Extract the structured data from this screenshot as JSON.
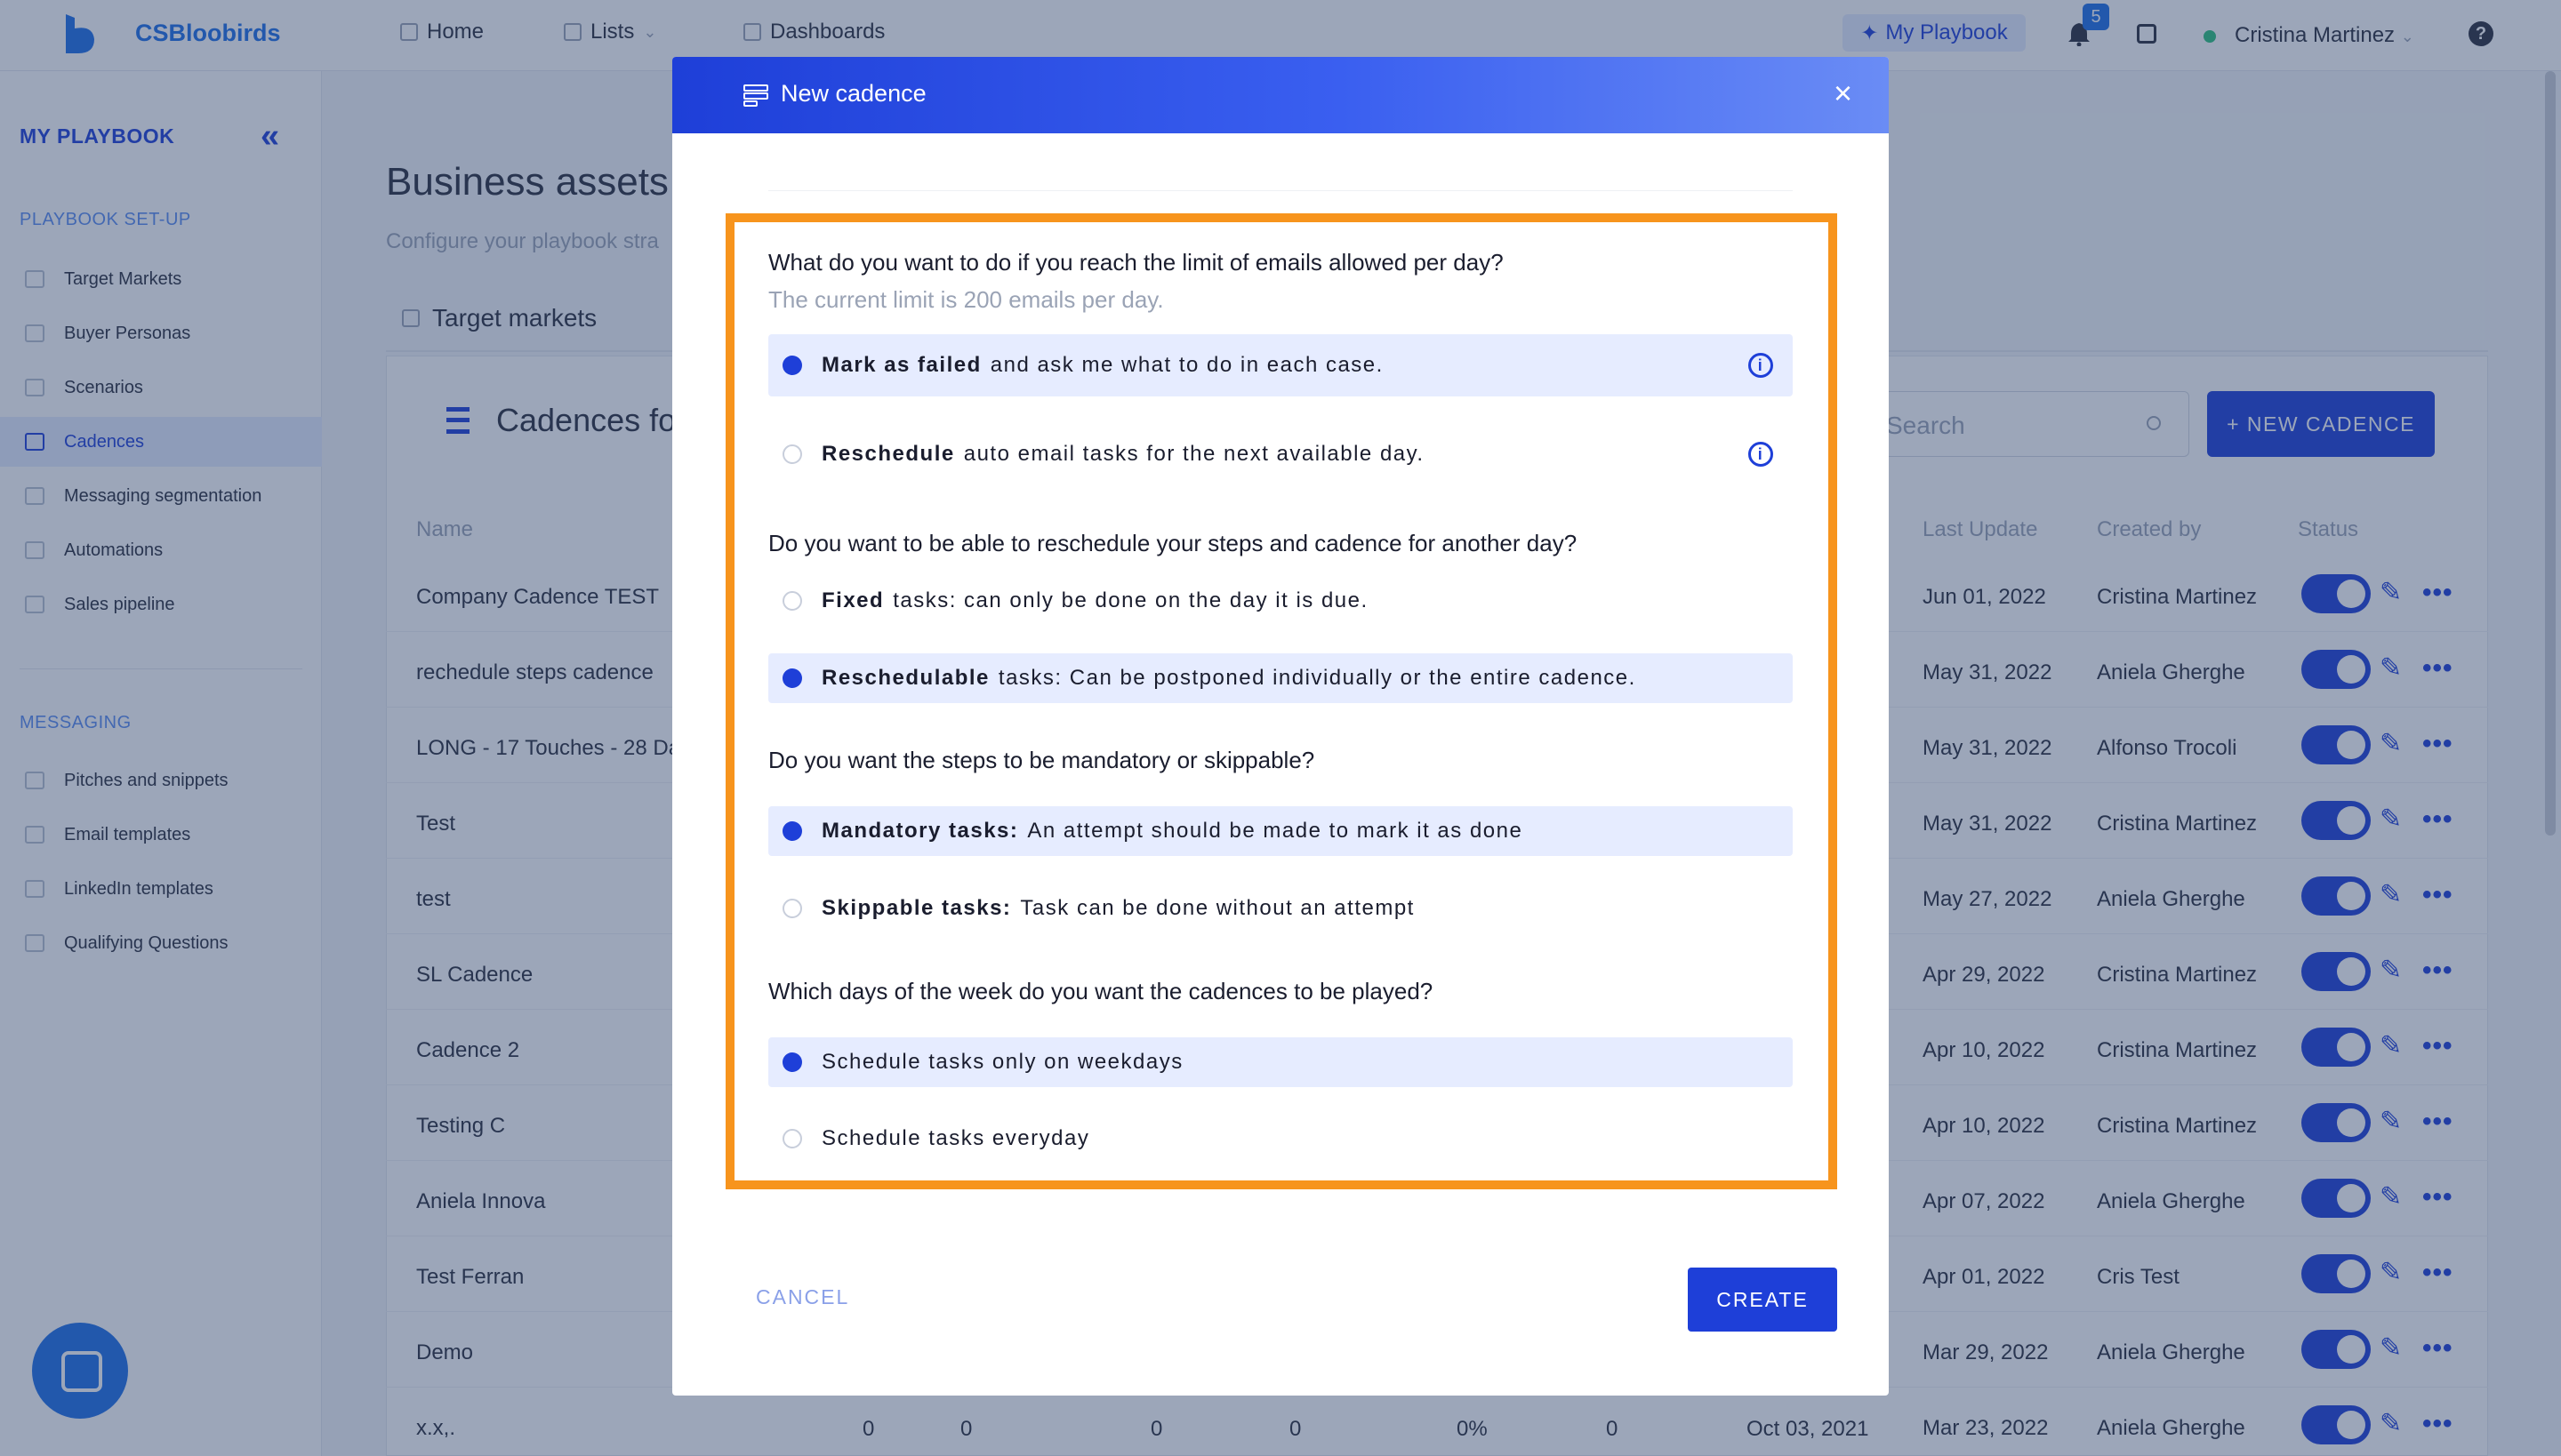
{
  "topnav": {
    "brand": "CSBloobirds",
    "home": "Home",
    "lists": "Lists",
    "dashboards": "Dashboards",
    "my_playbook": "My Playbook",
    "notif_count": "5",
    "user": "Cristina Martinez",
    "help": "?"
  },
  "sidebar": {
    "title": "MY PLAYBOOK",
    "setup_title": "PLAYBOOK SET-UP",
    "setup_items": [
      {
        "label": "Target Markets"
      },
      {
        "label": "Buyer Personas"
      },
      {
        "label": "Scenarios"
      },
      {
        "label": "Cadences"
      },
      {
        "label": "Messaging segmentation"
      },
      {
        "label": "Automations"
      },
      {
        "label": "Sales pipeline"
      }
    ],
    "messaging_title": "MESSAGING",
    "messaging_items": [
      {
        "label": "Pitches and snippets"
      },
      {
        "label": "Email templates"
      },
      {
        "label": "LinkedIn templates"
      },
      {
        "label": "Qualifying Questions"
      }
    ]
  },
  "main": {
    "title": "Business assets",
    "subtitle": "Configure your playbook stra",
    "tab_target": "Target markets",
    "card_title": "Cadences fo",
    "search_placeholder": "Search",
    "new_cadence": "+ NEW CADENCE",
    "headers": {
      "name": "Name",
      "last_update": "Last Update",
      "created_by": "Created by",
      "status": "Status"
    },
    "rows": [
      {
        "name": "Company Cadence TEST",
        "date": "Jun 01, 2022",
        "creator": "Cristina Martinez"
      },
      {
        "name": "rechedule steps cadence",
        "date": "May 31, 2022",
        "creator": "Aniela Gherghe"
      },
      {
        "name": "LONG - 17 Touches - 28 Da",
        "date": "May 31, 2022",
        "creator": "Alfonso Trocoli"
      },
      {
        "name": "Test",
        "date": "May 31, 2022",
        "creator": "Cristina Martinez"
      },
      {
        "name": "test",
        "date": "May 27, 2022",
        "creator": "Aniela Gherghe"
      },
      {
        "name": "SL Cadence",
        "date": "Apr 29, 2022",
        "creator": "Cristina Martinez"
      },
      {
        "name": "Cadence 2",
        "date": "Apr 10, 2022",
        "creator": "Cristina Martinez"
      },
      {
        "name": "Testing C",
        "date": "Apr 10, 2022",
        "creator": "Cristina Martinez"
      },
      {
        "name": "Aniela Innova",
        "date": "Apr 07, 2022",
        "creator": "Aniela Gherghe"
      },
      {
        "name": "Test Ferran",
        "date": "Apr 01, 2022",
        "creator": "Cris Test"
      },
      {
        "name": "Demo",
        "date": "Mar 29, 2022",
        "creator": "Aniela Gherghe"
      },
      {
        "name": "x.x,.",
        "date": "Mar 23, 2022",
        "creator": "Aniela Gherghe"
      }
    ],
    "last_row_extra": {
      "c1": "0",
      "c2": "0",
      "c3": "0",
      "c4": "0",
      "c5": "0%",
      "c6": "0",
      "c7": "Oct 03, 2021"
    }
  },
  "modal": {
    "title": "New cadence",
    "q1": "What do you want to do if you reach the limit of emails allowed per day?",
    "q1_sub": "The current limit is 200 emails per day.",
    "q1_opts": [
      {
        "bold": "Mark as failed",
        "text": "and ask me what to do in each case."
      },
      {
        "bold": "Reschedule",
        "text": "auto email tasks for the next available day."
      }
    ],
    "q2": "Do you want to be able to reschedule your steps and cadence for another day?",
    "q2_opts": [
      {
        "bold": "Fixed",
        "text": "tasks: can only be done on the day it is due."
      },
      {
        "bold": "Reschedulable",
        "text": "tasks: Can be postponed individually or the entire cadence."
      }
    ],
    "q3": "Do you want the steps to be mandatory or skippable?",
    "q3_opts": [
      {
        "bold": "Mandatory tasks:",
        "text": "An attempt should be made to mark it as done"
      },
      {
        "bold": "Skippable tasks:",
        "text": "Task can be done without an attempt"
      }
    ],
    "q4": "Which days of the week do you want the cadences to be played?",
    "q4_opts": [
      {
        "text": "Schedule tasks only on weekdays"
      },
      {
        "text": "Schedule tasks everyday"
      }
    ],
    "cancel": "CANCEL",
    "create": "CREATE"
  }
}
